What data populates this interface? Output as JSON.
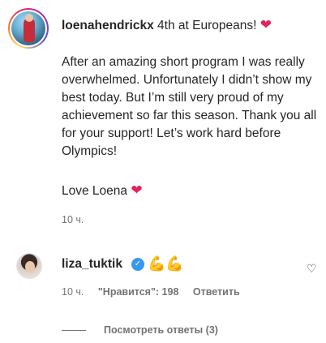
{
  "post": {
    "username": "loenahendrickx",
    "caption_head": " 4th at Europeans! ",
    "body": "After an amazing short program I was really overwhelmed. Unfortunately I didn’t show my best today. But I’m still very proud of my achievement so far this season. Thank you all for your support! Let’s work hard before Olympics!",
    "love_text": "Love Loena ",
    "heart_glyph": "❤",
    "time": "10 ч."
  },
  "reply": {
    "username": "liza_tuktik",
    "verified_glyph": "✓",
    "emoji": "💪💪",
    "time": "10 ч.",
    "likes": "\"Нравится\": 198",
    "reply_label": "Ответить",
    "like_icon": "♡"
  },
  "view_replies": {
    "label": "Посмотреть ответы (3)"
  }
}
